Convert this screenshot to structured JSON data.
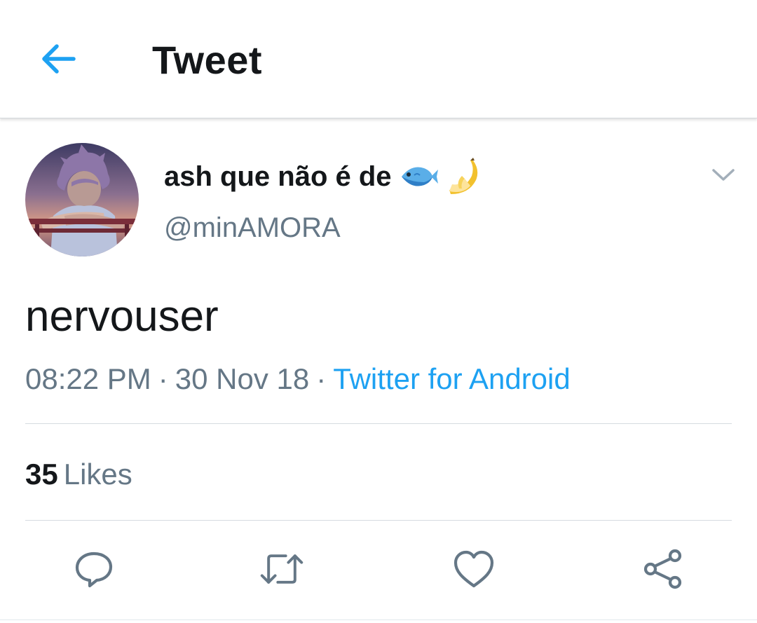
{
  "header": {
    "back_icon": "arrow-left-icon",
    "title": "Tweet"
  },
  "colors": {
    "accent": "#1da1f2",
    "text_primary": "#14171a",
    "text_secondary": "#657786",
    "icon_gray": "#657786",
    "divider": "#d6dbe0"
  },
  "tweet": {
    "author": {
      "display_name": "ash que não é de",
      "emojis": [
        "fish-icon",
        "banana-icon"
      ],
      "username": "@minAMORA",
      "avatar_icon": "avatar"
    },
    "menu_icon": "chevron-down-icon",
    "text": "nervouser",
    "time": "08:22 PM",
    "date": "30 Nov 18",
    "separator": "·",
    "source": "Twitter for Android",
    "likes": {
      "count": "35",
      "label": "Likes"
    }
  },
  "actions": [
    {
      "name": "reply",
      "icon": "reply-icon"
    },
    {
      "name": "retweet",
      "icon": "retweet-icon"
    },
    {
      "name": "like",
      "icon": "heart-icon"
    },
    {
      "name": "share",
      "icon": "share-icon"
    }
  ]
}
